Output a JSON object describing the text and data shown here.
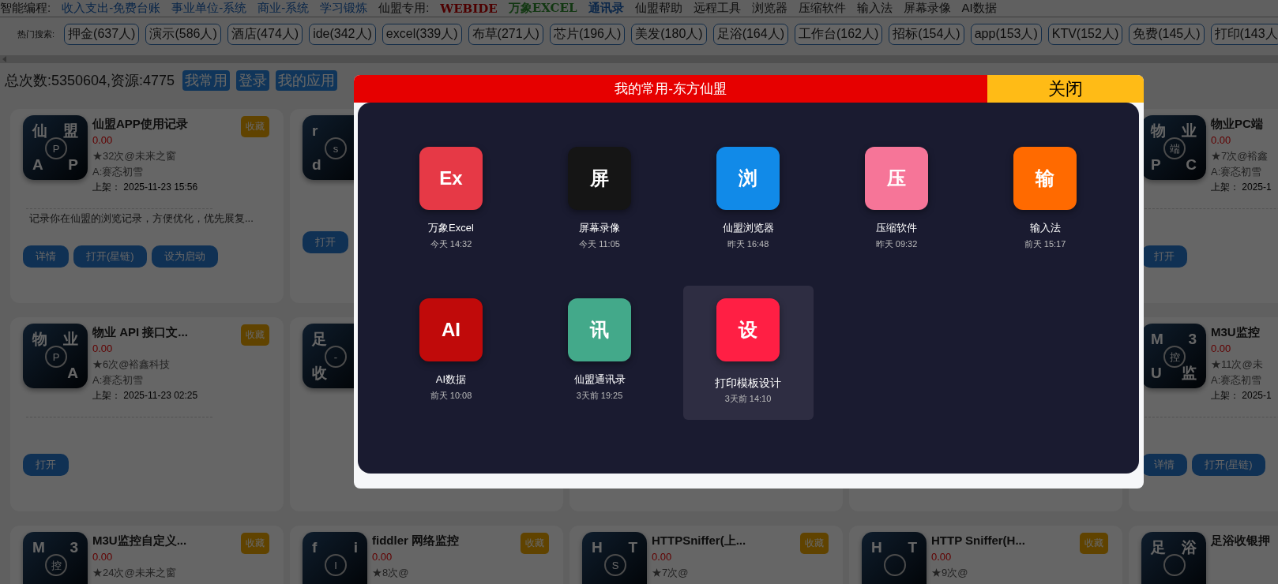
{
  "nav": [
    {
      "text": "智能编程:",
      "kind": "label"
    },
    {
      "text": "收入支出-免费台账",
      "kind": "link"
    },
    {
      "text": "事业单位-系统",
      "kind": "link"
    },
    {
      "text": "商业-系统",
      "kind": "link"
    },
    {
      "text": "学习锻炼",
      "kind": "link"
    },
    {
      "text": "仙盟专用:",
      "kind": "label"
    },
    {
      "text": "WEBIDE",
      "kind": "ide"
    },
    {
      "text": "万象EXCEL",
      "kind": "sheet"
    },
    {
      "text": "通讯录",
      "kind": "contacts"
    },
    {
      "text": "仙盟帮助",
      "kind": "label"
    },
    {
      "text": "远程工具",
      "kind": "label"
    },
    {
      "text": "浏览器",
      "kind": "label"
    },
    {
      "text": "压缩软件",
      "kind": "label"
    },
    {
      "text": "输入法",
      "kind": "label"
    },
    {
      "text": "屏幕录像",
      "kind": "label"
    },
    {
      "text": "AI数据",
      "kind": "label"
    }
  ],
  "hot_search": {
    "label": "热门搜索:",
    "tags": [
      "押金(637人)",
      "演示(586人)",
      "酒店(474人)",
      "ide(342人)",
      "excel(339人)",
      "布草(271人)",
      "芯片(196人)",
      "美发(180人)",
      "足浴(164人)",
      "工作台(162人)",
      "招标(154人)",
      "app(153人)",
      "KTV(152人)",
      "免费(145人)",
      "打印(143人"
    ]
  },
  "stats": {
    "text": "总次数:5350604,资源:4775",
    "buttons": [
      "我常用",
      "登录",
      "我的应用"
    ]
  },
  "card_rows": [
    {
      "cards": [
        {
          "kind": "app",
          "icon": {
            "tl": "仙",
            "tr": "盟",
            "bl": "A",
            "br": "P",
            "center": "P"
          },
          "title": "仙盟APP使用记录",
          "price": "0.00",
          "stats": "★32次@未来之窗",
          "author": "A:赛忞初雪",
          "date": "上架： 2025-11-23 15:56",
          "favorite": "收藏",
          "description": "记录你在仙盟的浏览记录，方便优化，优先展复...",
          "buttons": [
            "详情",
            "打开(星链)",
            "设为启动"
          ]
        },
        {
          "kind": "app",
          "icon": {
            "tl": "r",
            "bl": "d",
            "center": "s"
          },
          "buttons": [
            "打开"
          ]
        },
        {
          "kind": "covered"
        },
        {
          "kind": "covered"
        },
        {
          "kind": "app",
          "icon": {
            "tl": "物",
            "tr": "业",
            "bl": "P",
            "br": "C",
            "center": "端"
          },
          "title": "物业PC端",
          "price": "0.00",
          "stats": "★7次@裕鑫",
          "author": "A:赛忞初雪",
          "date": "上架： 2025-1",
          "buttons": [
            "打开"
          ]
        }
      ]
    },
    {
      "cards": [
        {
          "kind": "app",
          "icon": {
            "tl": "物",
            "tr": "业",
            "br": "A",
            "center": "P"
          },
          "title": "物业 API 接口文...",
          "price": "0.00",
          "stats": "★6次@裕鑫科技",
          "author": "A:赛忞初雪",
          "date": "上架： 2025-11-23 02:25",
          "favorite": "收藏",
          "buttons": [
            "打开"
          ]
        },
        {
          "kind": "app",
          "icon": {
            "tl": "足",
            "bl": "收",
            "center": "-"
          }
        },
        {
          "kind": "covered"
        },
        {
          "kind": "covered"
        },
        {
          "kind": "app",
          "icon": {
            "tl": "M",
            "tr": "3",
            "bl": "U",
            "br": "监",
            "center": "控"
          },
          "title": "M3U监控",
          "price": "0.00",
          "stats": "★11次@未",
          "author": "A:赛忞初雪",
          "date": "上架： 2025-1",
          "buttons": [
            "详情",
            "打开(星链)"
          ]
        }
      ]
    },
    {
      "cards": [
        {
          "kind": "app",
          "icon": {
            "tl": "M",
            "tr": "3",
            "center": "控"
          },
          "title": "M3U监控自定义...",
          "price": "0.00",
          "stats": "★24次@未来之窗",
          "favorite": "收藏"
        },
        {
          "kind": "app",
          "icon": {
            "tl": "f",
            "tr": "i",
            "center": "I"
          },
          "title": "fiddler 网络监控",
          "price": "0.00",
          "stats": "★8次@",
          "favorite": "收藏"
        },
        {
          "kind": "app",
          "icon": {
            "tl": "H",
            "tr": "T",
            "center": "S"
          },
          "title": "HTTPSniffer(上...",
          "price": "0.00",
          "stats": "★7次@",
          "favorite": "收藏"
        },
        {
          "kind": "app",
          "icon": {
            "tl": "H",
            "tr": "T"
          },
          "title": "HTTP Sniffer(H...",
          "price": "0.00",
          "stats": "★9次@",
          "favorite": "收藏"
        },
        {
          "kind": "app",
          "icon": {
            "tl": "足",
            "tr": "浴"
          },
          "title": "足浴收银押"
        }
      ]
    }
  ],
  "modal": {
    "title": "我的常用-东方仙盟",
    "close": "关闭",
    "items": [
      {
        "glyph": "Ex",
        "label": "万象Excel",
        "time": "今天 14:32",
        "color": "#e63946",
        "selected": false
      },
      {
        "glyph": "屏",
        "label": "屏幕录像",
        "time": "今天 11:05",
        "color": "#151515",
        "selected": false
      },
      {
        "glyph": "浏",
        "label": "仙盟浏览器",
        "time": "昨天 16:48",
        "color": "#118ae8",
        "selected": false
      },
      {
        "glyph": "压",
        "label": "压缩软件",
        "time": "昨天 09:32",
        "color": "#f67598",
        "selected": false
      },
      {
        "glyph": "输",
        "label": "输入法",
        "time": "前天 15:17",
        "color": "#ff6a00",
        "selected": false
      },
      {
        "glyph": "AI",
        "label": "AI数据",
        "time": "前天 10:08",
        "color": "#c00a0a",
        "selected": false
      },
      {
        "glyph": "讯",
        "label": "仙盟通讯录",
        "time": "3天前 19:25",
        "color": "#43a98a",
        "selected": false
      },
      {
        "glyph": "设",
        "label": "打印模板设计",
        "time": "3天前 14:10",
        "color": "#ff1f44",
        "selected": true
      }
    ]
  }
}
